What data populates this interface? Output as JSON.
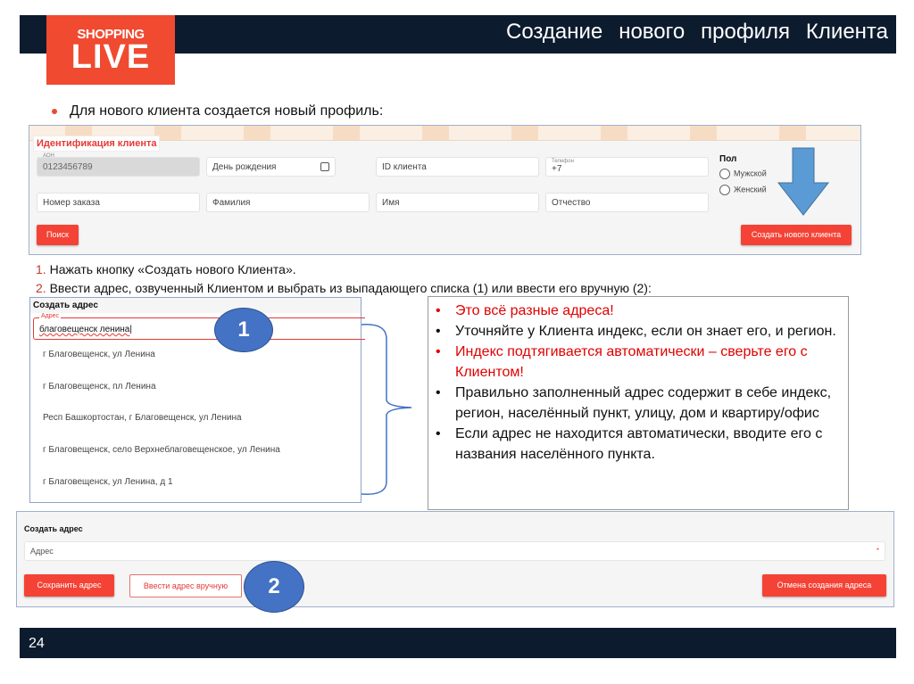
{
  "header": {
    "title": "Создание нового профиля Клиента",
    "logo_top": "SHOPPING",
    "logo_bottom": "LIVE"
  },
  "intro": "Для нового клиента создается новый профиль:",
  "client_form": {
    "section": "Идентификация клиента",
    "aon_label": "АОН",
    "aon_value": "0123456789",
    "birthday": "День рождения",
    "client_id": "ID клиента",
    "phone_label": "Телефон",
    "phone_value": "+7",
    "order_number": "Номер заказа",
    "last_name": "Фамилия",
    "first_name": "Имя",
    "patronymic": "Отчество",
    "gender_label": "Пол",
    "gender_options": [
      "Мужской",
      "Женский"
    ],
    "search_button": "Поиск",
    "create_button": "Создать нового клиента"
  },
  "steps": [
    {
      "num": "1.",
      "text": "Нажать кнопку «Создать нового Клиента»."
    },
    {
      "num": "2.",
      "text": "Ввести адрес, озвученный Клиентом и выбрать из выпадающего списка (1) или ввести его вручную (2):"
    }
  ],
  "dropdown": {
    "title": "Создать адрес",
    "field_label": "Адрес",
    "field_value": "благовещенск ленина",
    "options": [
      "г Благовещенск, ул Ленина",
      "г Благовещенск, пл Ленина",
      "Респ Башкортостан, г Благовещенск, ул Ленина",
      "г Благовещенск, село Верхнеблаговещенское, ул Ленина",
      "г Благовещенск, ул Ленина, д 1"
    ]
  },
  "markers": {
    "one": "1",
    "two": "2"
  },
  "notes": [
    {
      "text": "Это всё разные адреса!",
      "color": "red"
    },
    {
      "text": "Уточняйте у Клиента индекс, если он знает его, и регион.",
      "color": "black"
    },
    {
      "text": "Индекс подтягивается автоматически – сверьте его с Клиентом!",
      "color": "red"
    },
    {
      "text": "Правильно заполненный адрес содержит в себе индекс, регион, населённый пункт, улицу, дом и квартиру/офис",
      "color": "black"
    },
    {
      "text": "Если адрес не находится автоматически, вводите его с названия населённого пункта.",
      "color": "black"
    }
  ],
  "address_form": {
    "title": "Создать адрес",
    "placeholder": "Адрес",
    "required_mark": "*",
    "save_button": "Сохранить адрес",
    "manual_button": "Ввести адрес вручную",
    "cancel_button": "Отмена создания адреса"
  },
  "footer": {
    "page": "24"
  },
  "colors": {
    "navy": "#0d1b2e",
    "brand_red": "#f04a30",
    "button_red": "#f44336",
    "marker_blue": "#4472c4"
  }
}
